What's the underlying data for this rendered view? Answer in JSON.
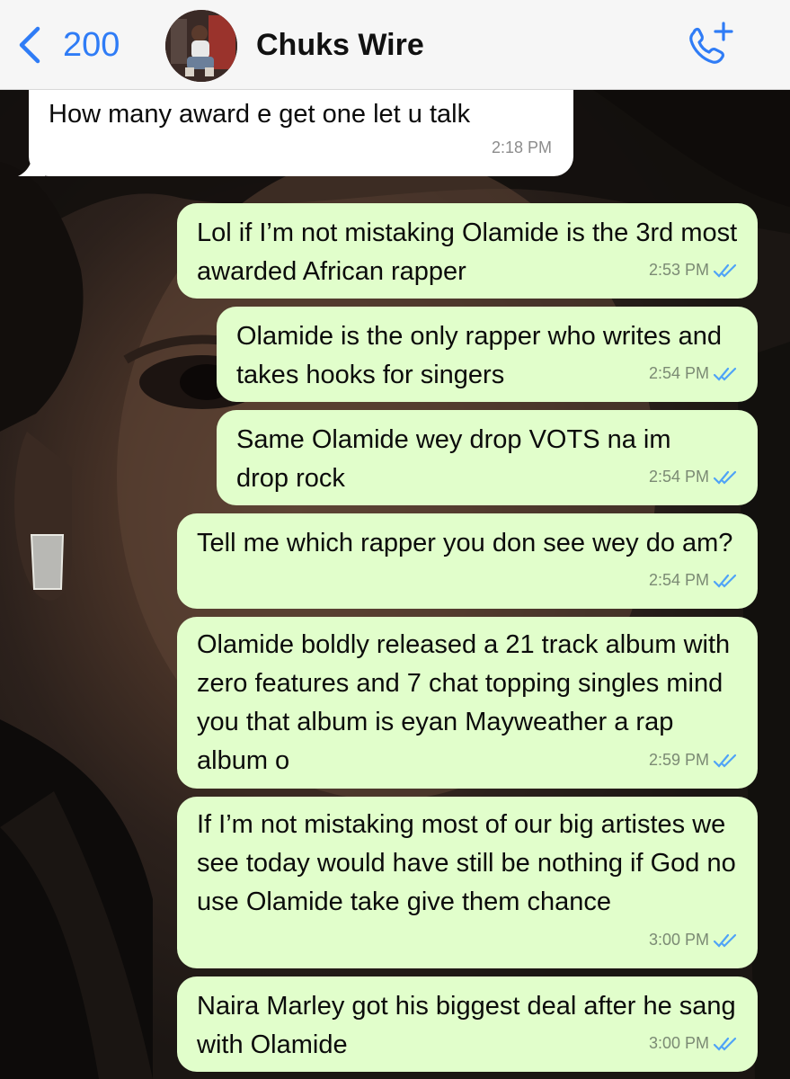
{
  "header": {
    "back_count": "200",
    "contact_name": "Chuks Wire"
  },
  "messages": [
    {
      "direction": "incoming",
      "text": "How many award e get one let u talk",
      "time": "2:18 PM"
    },
    {
      "direction": "outgoing",
      "text": "Lol if I’m not mistaking Olamide is the 3rd most awarded African rapper",
      "time": "2:53 PM",
      "status": "read"
    },
    {
      "direction": "outgoing",
      "text": "Olamide is the only rapper who writes and takes hooks for singers",
      "time": "2:54 PM",
      "status": "read"
    },
    {
      "direction": "outgoing",
      "text": "Same Olamide wey drop VOTS na im drop rock",
      "time": "2:54 PM",
      "status": "read"
    },
    {
      "direction": "outgoing",
      "text": "Tell me which rapper you don see wey do am?",
      "time": "2:54 PM",
      "status": "read"
    },
    {
      "direction": "outgoing",
      "text": "Olamide boldly released a 21 track album with zero features and 7 chat topping singles mind you that album is eyan Mayweather a rap album o",
      "time": "2:59 PM",
      "status": "read"
    },
    {
      "direction": "outgoing",
      "text": "If I’m not mistaking most of our big artistes we see today would have still be nothing if God no use Olamide take give them chance",
      "time": "3:00 PM",
      "status": "read"
    },
    {
      "direction": "outgoing",
      "text": "Naira Marley got his biggest deal after he sang with Olamide",
      "time": "3:00 PM",
      "status": "read"
    }
  ],
  "colors": {
    "accent": "#2f7cf6",
    "outgoing_bubble": "#e1fecb",
    "incoming_bubble": "#ffffff",
    "read_ticks": "#4fa3f7"
  },
  "icons": [
    "chevron-left-icon",
    "add-call-icon",
    "double-check-icon"
  ]
}
